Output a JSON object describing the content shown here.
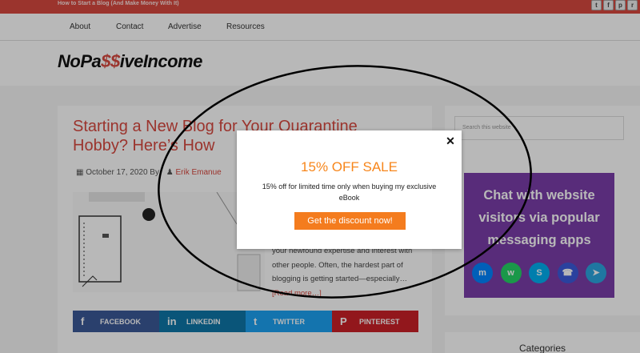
{
  "site": {
    "tagline": "How to Start a Blog (And Make Money With It)",
    "logo_pre": "NoPa",
    "logo_accent": "$$",
    "logo_post": "iveIncome",
    "social": [
      {
        "icon": "twitter-icon",
        "glyph": "t"
      },
      {
        "icon": "facebook-icon",
        "glyph": "f"
      },
      {
        "icon": "pinterest-icon",
        "glyph": "p"
      },
      {
        "icon": "rss-icon",
        "glyph": "r"
      }
    ]
  },
  "nav": {
    "items": [
      "About",
      "Contact",
      "Advertise",
      "Resources"
    ]
  },
  "post": {
    "title": "Starting a New Blog for Your Quarantine Hobby? Here’s How",
    "date": "October 17, 2020",
    "by": "By",
    "author": "Erik Emanue",
    "excerpt": "your newfound expertise and interest with other people. Often, the hardest part of blogging is getting started—especially…",
    "read_more": "[Read more…]"
  },
  "share": {
    "buttons": [
      {
        "label": "FACEBOOK",
        "glyph": "f",
        "color": "#3b5998"
      },
      {
        "label": "LINKEDIN",
        "glyph": "in",
        "color": "#0e76a8"
      },
      {
        "label": "TWITTER",
        "glyph": "t",
        "color": "#1da1f2"
      },
      {
        "label": "PINTEREST",
        "glyph": "P",
        "color": "#cb2027"
      }
    ]
  },
  "sidebar": {
    "search_placeholder": "Search this website",
    "ad_text": "Chat with website visitors via popular messaging apps",
    "ad_icons": [
      {
        "name": "messenger-icon",
        "glyph": "m",
        "color": "#0084ff"
      },
      {
        "name": "whatsapp-icon",
        "glyph": "w",
        "color": "#25d366"
      },
      {
        "name": "skype-icon",
        "glyph": "S",
        "color": "#00aff0"
      },
      {
        "name": "phone-icon",
        "glyph": "☎",
        "color": "#3b5bdb"
      },
      {
        "name": "telegram-icon",
        "glyph": "➤",
        "color": "#2ca5e0"
      }
    ],
    "categories_title": "Categories"
  },
  "modal": {
    "title": "15% OFF SALE",
    "body": "15% off for limited time only when buying my exclusive eBook",
    "cta": "Get the discount now!",
    "close_glyph": "✕"
  },
  "colors": {
    "brand_red": "#d7483f",
    "cta_orange": "#f47c1e",
    "ad_purple": "#7a3ea9"
  }
}
